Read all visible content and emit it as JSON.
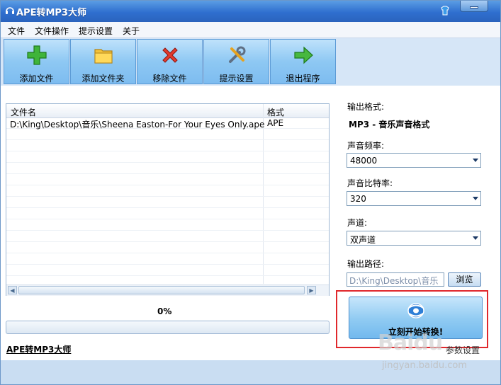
{
  "window": {
    "title": "APE转MP3大师"
  },
  "menu": [
    "文件",
    "文件操作",
    "提示设置",
    "关于"
  ],
  "toolbar": [
    {
      "label": "添加文件",
      "icon": "plus-icon"
    },
    {
      "label": "添加文件夹",
      "icon": "folder-icon"
    },
    {
      "label": "移除文件",
      "icon": "red-x-icon"
    },
    {
      "label": "提示设置",
      "icon": "tools-icon"
    },
    {
      "label": "退出程序",
      "icon": "arrow-right-icon"
    }
  ],
  "file_list": {
    "columns": [
      "文件名",
      "格式"
    ],
    "rows": [
      {
        "name": "D:\\King\\Desktop\\音乐\\Sheena Easton-For Your Eyes Only.ape",
        "format": "APE"
      }
    ]
  },
  "progress": {
    "label": "0%",
    "value": 0
  },
  "footer": {
    "link": "APE转MP3大师",
    "extra": "参数设置"
  },
  "settings": {
    "output_format_label": "输出格式:",
    "output_format_value": "MP3 - 音乐声音格式",
    "sample_rate_label": "声音频率:",
    "sample_rate_value": "48000",
    "bitrate_label": "声音比特率:",
    "bitrate_value": "320",
    "channel_label": "声道:",
    "channel_value": "双声道",
    "output_path_label": "输出路径:",
    "output_path_value": "D:\\King\\Desktop\\音乐",
    "browse_label": "浏览"
  },
  "convert": {
    "label": "立刻开始转换!"
  },
  "watermark": {
    "line1": "Baidu",
    "line2": "jingyan.baidu.com"
  },
  "colors": {
    "accent": "#2f6fcf",
    "highlight": "#e0282c"
  }
}
